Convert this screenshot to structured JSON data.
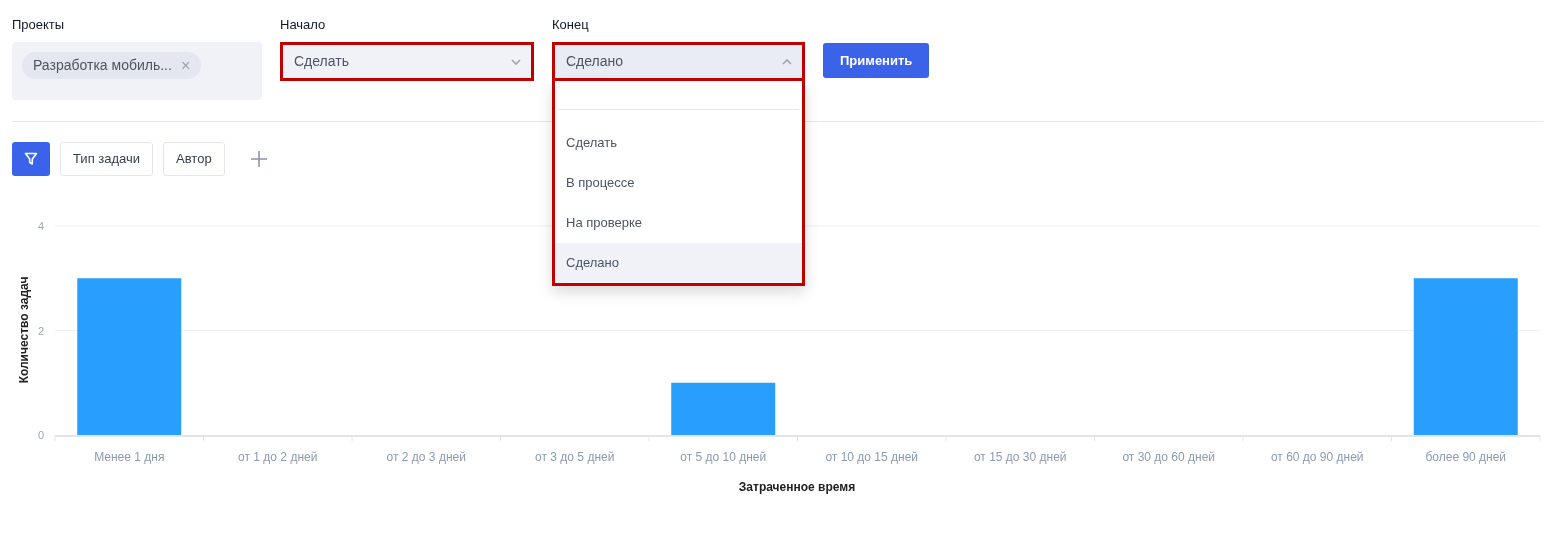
{
  "filters": {
    "projects": {
      "label": "Проекты",
      "tags": [
        {
          "text": "Разработка мобиль...",
          "remove": "×"
        }
      ]
    },
    "start": {
      "label": "Начало",
      "value": "Сделать",
      "highlighted": true,
      "expanded": false
    },
    "end": {
      "label": "Конец",
      "value": "Сделано",
      "highlighted": true,
      "expanded": true,
      "options": [
        {
          "text": "Сделать",
          "selected": false
        },
        {
          "text": "В процессе",
          "selected": false
        },
        {
          "text": "На проверке",
          "selected": false
        },
        {
          "text": "Сделано",
          "selected": true
        }
      ]
    },
    "apply_button": "Применить"
  },
  "toolbar": {
    "chips": [
      "Тип задачи",
      "Автор"
    ]
  },
  "chart": {
    "chart_data": {
      "type": "bar",
      "xlabel": "Затраченное время",
      "ylabel": "Количество задач",
      "categories": [
        "Менее 1 дня",
        "от 1 до 2 дней",
        "от 2 до 3 дней",
        "от 3 до 5 дней",
        "от 5 до 10 дней",
        "от 10 до 15 дней",
        "от 15 до 30 дней",
        "от 30 до 60 дней",
        "от 60 до 90 дней",
        "более 90 дней"
      ],
      "series": [
        {
          "color": "#289ffc",
          "values": [
            3,
            0,
            0,
            0,
            1,
            0,
            0,
            0,
            0,
            3
          ]
        }
      ],
      "ylim": [
        0,
        4
      ],
      "yticks": [
        0,
        2,
        4
      ]
    }
  }
}
